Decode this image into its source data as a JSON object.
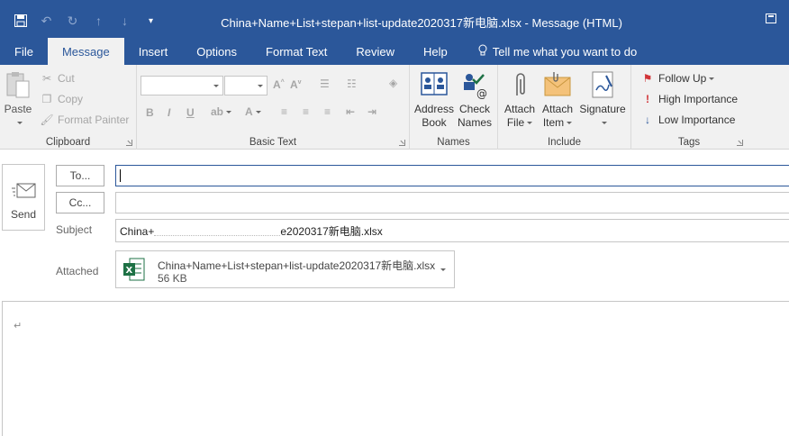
{
  "window": {
    "title": "China+Name+List+stepan+list-update2020317新电脑.xlsx  -  Message (HTML)"
  },
  "qat": {
    "save_icon": "save-icon",
    "undo_icon": "undo-icon",
    "redo_icon": "redo-icon",
    "up_icon": "up-arrow-icon",
    "down_icon": "down-arrow-icon",
    "customize_icon": "customize-qat-icon"
  },
  "tabs": [
    {
      "label": "File"
    },
    {
      "label": "Message"
    },
    {
      "label": "Insert"
    },
    {
      "label": "Options"
    },
    {
      "label": "Format Text"
    },
    {
      "label": "Review"
    },
    {
      "label": "Help"
    },
    {
      "label": "Tell me what you want to do"
    }
  ],
  "ribbon": {
    "clipboard": {
      "label": "Clipboard",
      "paste": "Paste",
      "cut": "Cut",
      "copy": "Copy",
      "format_painter": "Format Painter"
    },
    "basic_text": {
      "label": "Basic Text",
      "bold": "B",
      "italic": "I",
      "underline": "U"
    },
    "names": {
      "label": "Names",
      "address_book_1": "Address",
      "address_book_2": "Book",
      "check_names_1": "Check",
      "check_names_2": "Names"
    },
    "include": {
      "label": "Include",
      "attach_file_1": "Attach",
      "attach_file_2": "File",
      "attach_item_1": "Attach",
      "attach_item_2": "Item",
      "signature": "Signature"
    },
    "tags": {
      "label": "Tags",
      "follow_up": "Follow Up",
      "high_importance": "High Importance",
      "low_importance": "Low Importance"
    }
  },
  "compose": {
    "send": "Send",
    "to_button": "To...",
    "cc_button": "Cc...",
    "to_value": "",
    "cc_value": "",
    "subject_label": "Subject",
    "subject_value": "China+",
    "subject_value_end": "e2020317新电脑.xlsx",
    "attached_label": "Attached",
    "attachment": {
      "name": "China+Name+List+stepan+list-update2020317新电脑.xlsx",
      "size": "56 KB"
    },
    "body_mark": "↵"
  },
  "colors": {
    "accent": "#2b579a",
    "ribbon_bg": "#f1f1f1",
    "excel_green": "#1e7145",
    "follow_up_red": "#d13438",
    "low_importance_blue": "#2b579a"
  }
}
